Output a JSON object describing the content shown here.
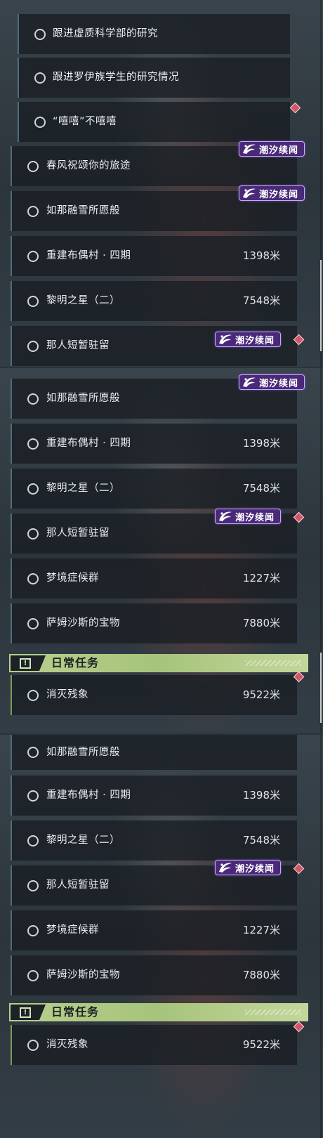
{
  "badge_text": "潮汐续闻",
  "daily_title": "日常任务",
  "panels": [
    {
      "items": [
        {
          "label": "跟进虚质科学部的研究",
          "distance": ""
        },
        {
          "label": "跟进罗伊族学生的研究情况",
          "distance": ""
        },
        {
          "label": "“嘻嘻”不嘻嘻",
          "distance": ""
        },
        {
          "label": "春风祝颂你的旅途",
          "distance": ""
        },
        {
          "label": "如那融雪所愿般",
          "distance": ""
        },
        {
          "label": "重建布偶村 · 四期",
          "distance": "1398米"
        },
        {
          "label": "黎明之星（二）",
          "distance": "7548米"
        },
        {
          "label": "那人短暂驻留",
          "distance": ""
        }
      ]
    },
    {
      "items": [
        {
          "label": "如那融雪所愿般",
          "distance": ""
        },
        {
          "label": "重建布偶村 · 四期",
          "distance": "1398米"
        },
        {
          "label": "黎明之星（二）",
          "distance": "7548米"
        },
        {
          "label": "那人短暂驻留",
          "distance": ""
        },
        {
          "label": "梦境症候群",
          "distance": "1227米"
        },
        {
          "label": "萨姆沙斯的宝物",
          "distance": "7880米"
        }
      ],
      "daily_items": [
        {
          "label": "消灭残象",
          "distance": "9522米"
        }
      ]
    },
    {
      "items": [
        {
          "label": "如那融雪所愿般",
          "distance": ""
        },
        {
          "label": "重建布偶村 · 四期",
          "distance": "1398米"
        },
        {
          "label": "黎明之星（二）",
          "distance": "7548米"
        },
        {
          "label": "那人短暂驻留",
          "distance": ""
        },
        {
          "label": "梦境症候群",
          "distance": "1227米"
        },
        {
          "label": "萨姆沙斯的宝物",
          "distance": "7880米"
        }
      ],
      "daily_items": [
        {
          "label": "消灭残象",
          "distance": "9522米"
        }
      ]
    }
  ],
  "colors": {
    "badge_bg": "#4a2a78",
    "badge_border": "#c9a9ff",
    "gem": "#d45567",
    "daily_header": "#a6c47b",
    "daily_accent": "#7f9b58",
    "quest_accent": "#4f6d78"
  },
  "icons": {
    "badge": "tidal-swirl-icon",
    "row": "circle-outline-icon",
    "daily_header": "exclamation-box-icon",
    "marker": "red-diamond-icon"
  }
}
